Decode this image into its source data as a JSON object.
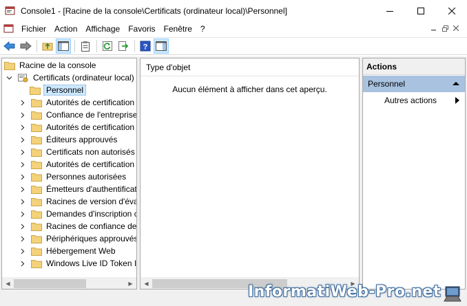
{
  "window": {
    "title": "Console1 - [Racine de la console\\Certificats (ordinateur local)\\Personnel]",
    "minimize_glyph": "—",
    "maximize_glyph": "☐",
    "close_glyph": "✕"
  },
  "menu": {
    "items": [
      "Fichier",
      "Action",
      "Affichage",
      "Favoris",
      "Fenêtre",
      "?"
    ]
  },
  "tree": {
    "root": "Racine de la console",
    "certs": "Certificats (ordinateur local)",
    "items": [
      "Personnel",
      "Autorités de certification",
      "Confiance de l'entreprise",
      "Autorités de certification",
      "Éditeurs approuvés",
      "Certificats non autorisés",
      "Autorités de certification",
      "Personnes autorisées",
      "Émetteurs d'authentificat",
      "Racines de version d'évalu",
      "Demandes d'inscription c",
      "Racines de confiance de c",
      "Périphériques approuvés",
      "Hébergement Web",
      "Windows Live ID Token Is"
    ]
  },
  "result": {
    "column_header": "Type d'objet",
    "empty_message": "Aucun élément à afficher dans cet aperçu."
  },
  "actions": {
    "title": "Actions",
    "section": "Personnel",
    "more_actions": "Autres actions"
  },
  "watermark": {
    "text": "InformatiWeb-Pro.net"
  },
  "colors": {
    "selection": "#cce8ff",
    "actions_section": "#a8c2e0",
    "folder": "#f4d27a"
  }
}
